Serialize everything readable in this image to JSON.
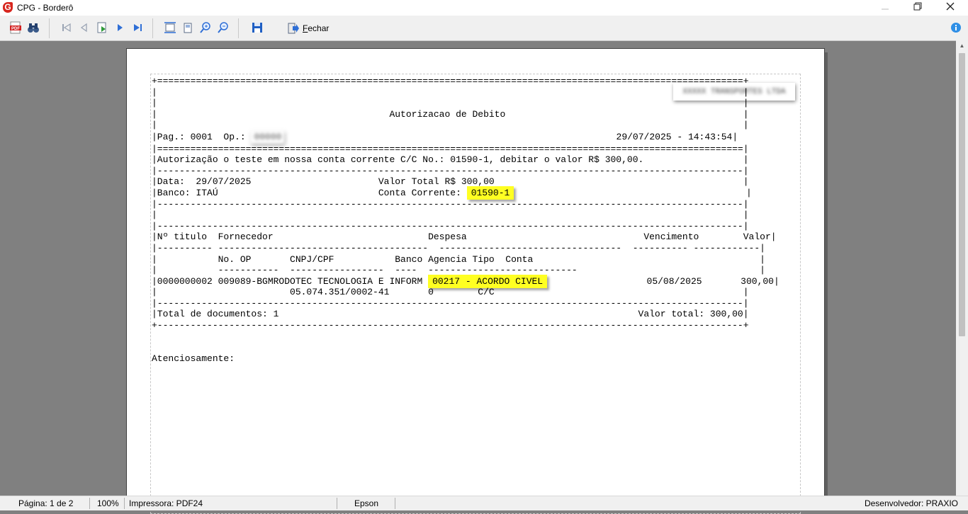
{
  "window": {
    "title": "CPG - Borderô",
    "minimize_icon": "minimize-icon",
    "maximize_icon": "restore-icon",
    "close_icon": "close-icon"
  },
  "toolbar": {
    "close_label_first": "F",
    "close_label_rest": "echar",
    "icons": [
      "pdf-export-icon",
      "binoculars-search-icon",
      "first-page-icon",
      "previous-page-icon",
      "goto-page-icon",
      "next-page-icon",
      "last-page-icon",
      "page-width-icon",
      "whole-page-icon",
      "zoom-in-icon",
      "zoom-out-icon",
      "save-icon",
      "exit-icon",
      "help-icon"
    ]
  },
  "report": {
    "line_top": "+==========================================================================================================+",
    "line_blank": "|                                                                                                          |",
    "title_line": "|                                          Autorizacao de Debito                                           |",
    "pag_prefix": "|Pag.: 0001  Op.: ",
    "op_blur": "00000",
    "pag_mid": "                                                            ",
    "datetime": "29/07/2025 - 14:43:54|",
    "line_eq": "|==========================================================================================================|",
    "auth_line": "|Autorização o teste em nossa conta corrente C/C No.: 01590-1, debitar o valor R$ 300,00.                  |",
    "line_dash": "|----------------------------------------------------------------------------------------------------------|",
    "data_line": "|Data:  29/07/2025                       Valor Total R$ 300,00                                             |",
    "banco_prefix": "|Banco: ITAÚ                             Conta Corrente: ",
    "conta_corrente": "01590-1",
    "banco_suffix": "                                          |",
    "header_line": "|Nº titulo  Fornecedor                            Despesa                                Vencimento        Valor|",
    "header_under": "|---------- --------------------------------------  ---------------------------------  ---------- ------------|",
    "sub_header": "|           No. OP       CNPJ/CPF           Banco Agencia Tipo  Conta                                         |",
    "sub_under": "|           -----------  -----------------  ----  ---------------------------                                 |",
    "item_prefix": "|0000000002 009089-BGMRODOTEC TECNOLOGIA E INFORM ",
    "despesa": "00217 - ACORDO CIVEL",
    "item_suffix": "                  05/08/2025       300,00|",
    "item_line2": "|                        05.074.351/0002-41       0        C/C                                             |",
    "total_line": "|Total de documentos: 1                                                                 Valor total: 300,00|",
    "line_bottom": "+----------------------------------------------------------------------------------------------------------+",
    "closing": "Atenciosamente:",
    "company_blur": "XXXXX TRANSPORTES LTDA"
  },
  "status": {
    "page": "Página: 1 de 2",
    "zoom": "100%",
    "printer": "Impressora: PDF24",
    "paper": "Epson",
    "developer": "Desenvolvedor: PRAXIO"
  }
}
